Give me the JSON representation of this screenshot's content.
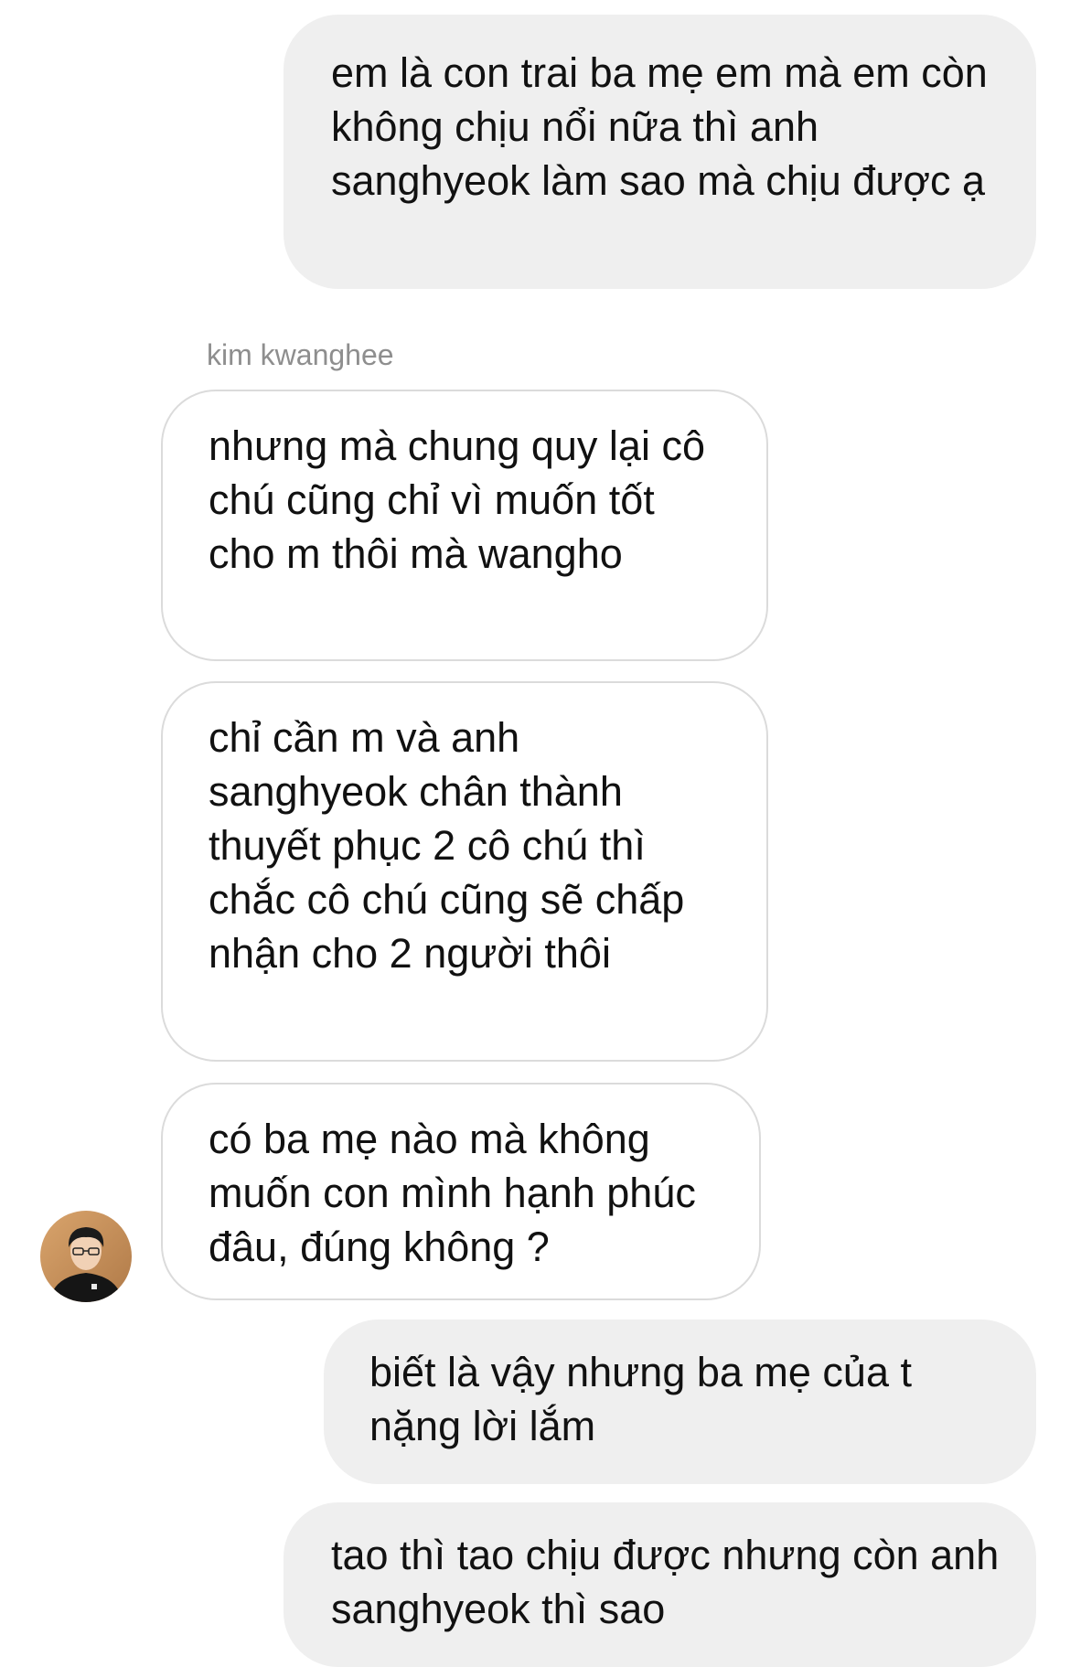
{
  "thread": {
    "sender_name": "kim kwanghee",
    "messages": [
      {
        "direction": "outgoing",
        "text": "em là con trai ba mẹ em mà em còn không chịu nổi nữa thì anh sanghyeok làm sao mà chịu được ạ"
      },
      {
        "direction": "incoming",
        "text": "nhưng mà chung quy lại cô chú cũng chỉ vì muốn tốt cho m thôi mà wangho"
      },
      {
        "direction": "incoming",
        "text": "chỉ cần m và anh sanghyeok chân thành thuyết phục 2 cô chú thì chắc cô chú cũng sẽ chấp nhận cho 2 người thôi"
      },
      {
        "direction": "incoming",
        "text": "có ba mẹ nào mà không muốn con mình hạnh phúc đâu, đúng không ?"
      },
      {
        "direction": "outgoing",
        "text": "biết là vậy nhưng ba mẹ của t nặng lời lắm"
      },
      {
        "direction": "outgoing",
        "text": "tao thì tao chịu được nhưng còn anh sanghyeok thì sao"
      }
    ]
  },
  "colors": {
    "outgoing_bubble": "#efefef",
    "incoming_border": "#dbdbdb",
    "sender_text": "#8e8e8e",
    "message_text": "#111111"
  }
}
